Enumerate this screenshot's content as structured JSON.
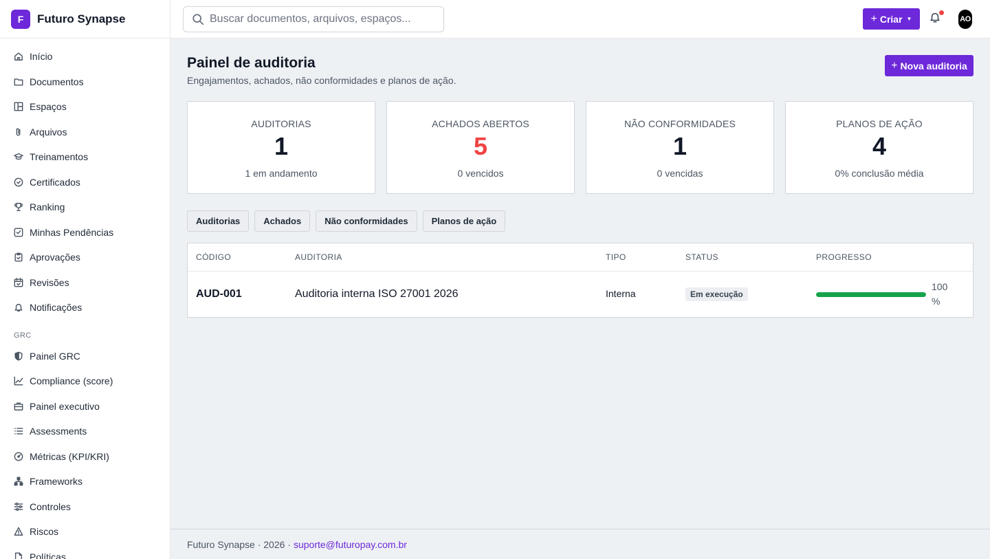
{
  "brand": {
    "logo_letter": "F",
    "name": "Futuro Synapse"
  },
  "sidebar": {
    "items": [
      {
        "label": "Início",
        "icon": "home-icon"
      },
      {
        "label": "Documentos",
        "icon": "folder-icon"
      },
      {
        "label": "Espaços",
        "icon": "layout-icon"
      },
      {
        "label": "Arquivos",
        "icon": "paperclip-icon"
      },
      {
        "label": "Treinamentos",
        "icon": "graduation-cap-icon"
      },
      {
        "label": "Certificados",
        "icon": "badge-check-icon"
      },
      {
        "label": "Ranking",
        "icon": "trophy-icon"
      },
      {
        "label": "Minhas Pendências",
        "icon": "checkbox-icon"
      },
      {
        "label": "Aprovações",
        "icon": "clipboard-icon"
      },
      {
        "label": "Revisões",
        "icon": "calendar-check-icon"
      },
      {
        "label": "Notificações",
        "icon": "bell-icon"
      }
    ],
    "grc_section": "GRC",
    "grc_items": [
      {
        "label": "Painel GRC",
        "icon": "shield-icon"
      },
      {
        "label": "Compliance (score)",
        "icon": "line-chart-icon"
      },
      {
        "label": "Painel executivo",
        "icon": "briefcase-icon"
      },
      {
        "label": "Assessments",
        "icon": "list-icon"
      },
      {
        "label": "Métricas (KPI/KRI)",
        "icon": "gauge-icon"
      },
      {
        "label": "Frameworks",
        "icon": "network-icon"
      },
      {
        "label": "Controles",
        "icon": "sliders-icon"
      },
      {
        "label": "Riscos",
        "icon": "warning-icon"
      },
      {
        "label": "Políticas",
        "icon": "file-icon"
      }
    ]
  },
  "topbar": {
    "search_placeholder": "Buscar documentos, arquivos, espaços...",
    "create_label": "Criar",
    "avatar_initials": "AO"
  },
  "page": {
    "title": "Painel de auditoria",
    "subtitle": "Engajamentos, achados, não conformidades e planos de ação.",
    "new_button_label": "Nova auditoria"
  },
  "cards": [
    {
      "label": "AUDITORIAS",
      "value": "1",
      "sub": "1 em andamento"
    },
    {
      "label": "ACHADOS ABERTOS",
      "value": "5",
      "sub": "0 vencidos"
    },
    {
      "label": "NÃO CONFORMIDADES",
      "value": "1",
      "sub": "0 vencidas"
    },
    {
      "label": "PLANOS DE AÇÃO",
      "value": "4",
      "sub": "0% conclusão média"
    }
  ],
  "tabs": [
    "Auditorias",
    "Achados",
    "Não conformidades",
    "Planos de ação"
  ],
  "table": {
    "headers": [
      "CÓDIGO",
      "AUDITORIA",
      "TIPO",
      "STATUS",
      "PROGRESSO"
    ],
    "rows": [
      {
        "code": "AUD-001",
        "name": "Auditoria interna ISO 27001 2026",
        "type": "Interna",
        "status": "Em execução",
        "progress": 100,
        "progress_text": "100 %"
      }
    ]
  },
  "footer": {
    "text": "Futuro Synapse · 2026 ·",
    "email": "suporte@futuropay.com.br"
  },
  "colors": {
    "accent": "#6d28d9",
    "alert": "#ef4444",
    "progress": "#16a34a"
  }
}
